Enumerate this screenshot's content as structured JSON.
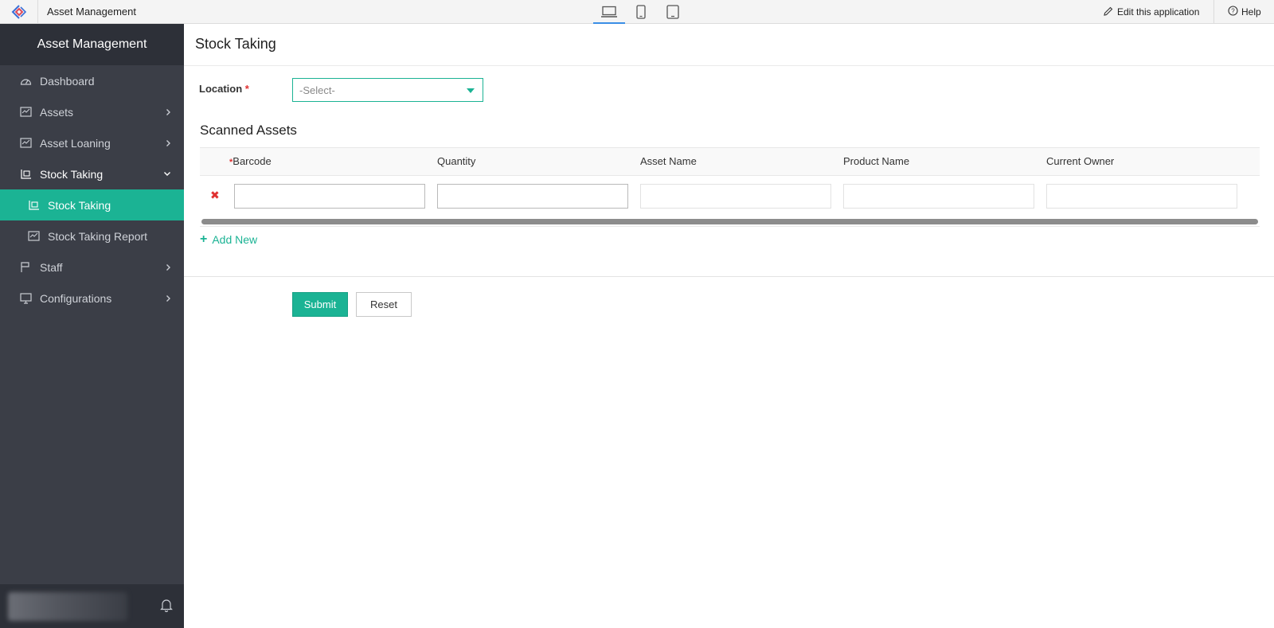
{
  "topbar": {
    "logo_icon": "app-logo-icon",
    "app_title": "Asset Management",
    "devices": [
      {
        "name": "laptop-icon",
        "active": true
      },
      {
        "name": "phone-icon",
        "active": false
      },
      {
        "name": "tablet-icon",
        "active": false
      }
    ],
    "edit_label": "Edit this application",
    "help_label": "Help"
  },
  "sidebar": {
    "brand": "Asset Management",
    "items": [
      {
        "label": "Dashboard",
        "icon": "dashboard-icon"
      },
      {
        "label": "Assets",
        "icon": "assets-icon"
      },
      {
        "label": "Asset Loaning",
        "icon": "asset-loaning-icon"
      },
      {
        "label": "Stock Taking",
        "icon": "stock-taking-icon"
      },
      {
        "label": "Stock Taking",
        "icon": "stock-taking-sub-icon"
      },
      {
        "label": "Stock Taking Report",
        "icon": "report-icon"
      },
      {
        "label": "Staff",
        "icon": "staff-icon"
      },
      {
        "label": "Configurations",
        "icon": "configurations-icon"
      }
    ]
  },
  "form": {
    "page_title": "Stock Taking",
    "location_label": "Location",
    "required_mark": "*",
    "location_placeholder": "-Select-",
    "section_title": "Scanned Assets",
    "columns": [
      "Barcode",
      "Quantity",
      "Asset Name",
      "Product Name",
      "Current Owner"
    ],
    "delete_icon": "✖",
    "add_new_label": "Add New",
    "submit_label": "Submit",
    "reset_label": "Reset"
  },
  "colors": {
    "accent": "#1bb394",
    "sidebar_bg": "#3b3e47",
    "sidebar_dark": "#2d3038",
    "required": "#e03131"
  }
}
